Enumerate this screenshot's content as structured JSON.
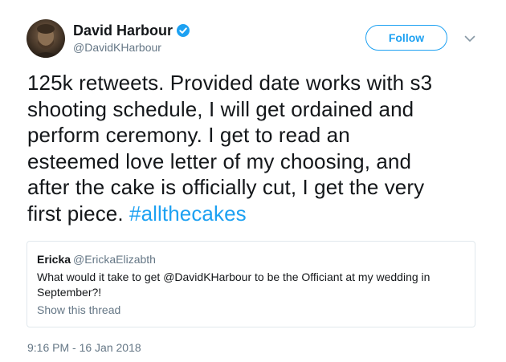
{
  "author": {
    "display_name": "David Harbour",
    "handle": "@DavidKHarbour",
    "verified": true,
    "avatar_icon": "user-avatar-photo"
  },
  "follow_button": {
    "label": "Follow"
  },
  "more_menu": {
    "icon": "chevron-down-icon"
  },
  "tweet": {
    "lines": [
      "125k retweets.  Provided date works with s3",
      "shooting schedule, I will get ordained and",
      "perform ceremony.  I get to read an",
      "esteemed love letter of my choosing, and",
      "after the cake is officially cut, I get the very"
    ],
    "last_line_text": "first piece. ",
    "hashtag": "#allthecakes"
  },
  "quoted_tweet": {
    "display_name": "Ericka",
    "handle": "@Eric​kaElizabth",
    "text_lines": [
      "What would it take to get @DavidKHarbour to be the Officiant at my wedding in",
      "September?!"
    ],
    "show_thread_label": "Show this thread"
  },
  "timestamp": "9:16 PM - 16 Jan 2018",
  "colors": {
    "accent": "#1da1f2",
    "text": "#14171a",
    "secondary_text": "#657786",
    "border": "#e1e8ed"
  }
}
